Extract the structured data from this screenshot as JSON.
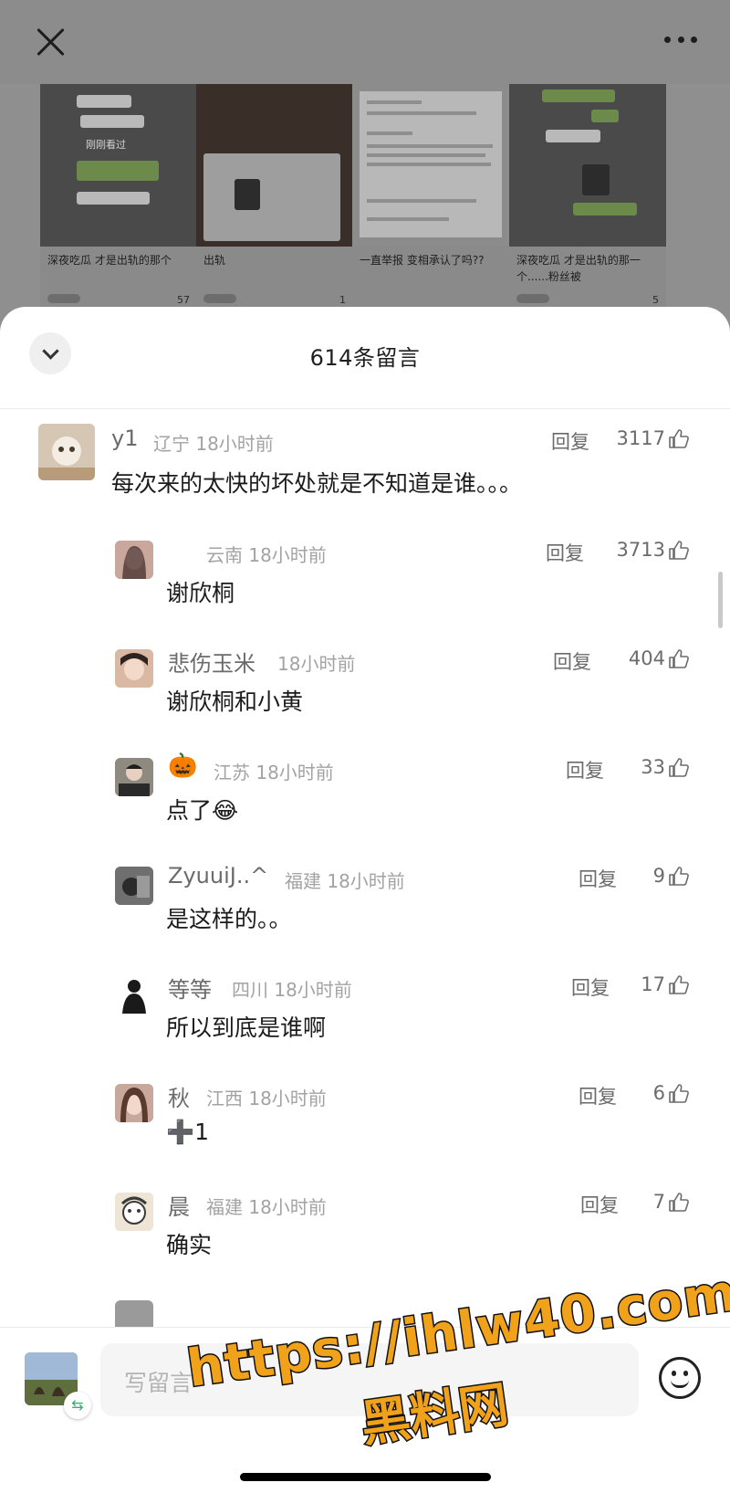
{
  "sheet": {
    "title": "614条留言"
  },
  "background": {
    "cards": [
      {
        "caption": "深夜吃瓜 才是出轨的那个",
        "likes": "57",
        "screen_label": "刚刚看过"
      },
      {
        "caption": "出轨",
        "likes": "1"
      },
      {
        "caption": "一直举报 变相承认了吗??",
        "likes": ""
      },
      {
        "caption": "深夜吃瓜 才是出轨的那一个......粉丝被",
        "likes": "5"
      }
    ]
  },
  "comments": [
    {
      "user": "y1",
      "location": "辽宁",
      "time": "18小时前",
      "text": "每次来的太快的坏处就是不知道是谁。。。",
      "reply_label": "回复",
      "likes": "3117",
      "level": "main"
    },
    {
      "user": "",
      "location": "云南",
      "time": "18小时前",
      "text": "谢欣桐",
      "reply_label": "回复",
      "likes": "3713",
      "level": "reply"
    },
    {
      "user": "悲伤玉米",
      "location": "",
      "time": "18小时前",
      "text": "谢欣桐和小黄",
      "reply_label": "回复",
      "likes": "404",
      "level": "reply"
    },
    {
      "user": "🎃",
      "location": "江苏",
      "time": "18小时前",
      "text": "点了😂",
      "reply_label": "回复",
      "likes": "33",
      "level": "reply"
    },
    {
      "user": "ZyuuiJ..^",
      "location": "福建",
      "time": "18小时前",
      "text": "是这样的。。",
      "reply_label": "回复",
      "likes": "9",
      "level": "reply"
    },
    {
      "user": "等等",
      "location": "四川",
      "time": "18小时前",
      "text": "所以到底是谁啊",
      "reply_label": "回复",
      "likes": "17",
      "level": "reply"
    },
    {
      "user": "秋",
      "location": "江西",
      "time": "18小时前",
      "text": "➕1",
      "reply_label": "回复",
      "likes": "6",
      "level": "reply"
    },
    {
      "user": "晨",
      "location": "福建",
      "time": "18小时前",
      "text": "确实",
      "reply_label": "回复",
      "likes": "7",
      "level": "reply"
    }
  ],
  "input": {
    "placeholder": "写留言"
  },
  "watermark": {
    "url": "https://ihlw40.com",
    "name": "黑料网"
  },
  "icons": {
    "close": "close-icon",
    "more": "more-icon",
    "collapse": "chevron-down-icon",
    "like": "thumbs-up-icon",
    "emoji": "emoji-icon",
    "switch": "switch-account-icon"
  }
}
